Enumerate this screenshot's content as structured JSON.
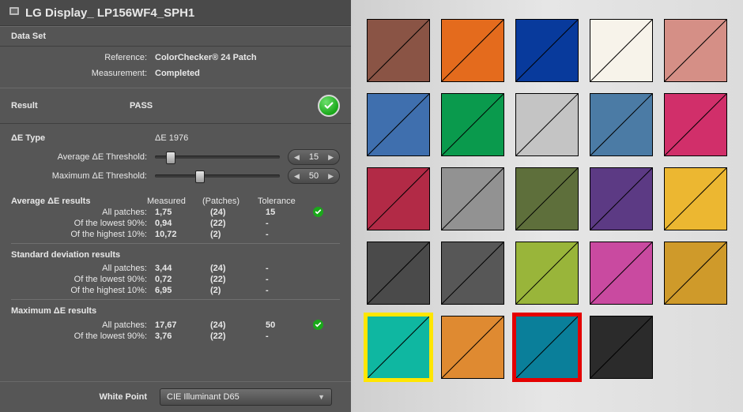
{
  "title": "LG Display_  LP156WF4_SPH1",
  "dataset": {
    "section_label": "Data Set",
    "reference_label": "Reference:",
    "reference_value": "ColorChecker® 24 Patch",
    "measurement_label": "Measurement:",
    "measurement_value": "Completed"
  },
  "result": {
    "label": "Result",
    "value": "PASS"
  },
  "de_type": {
    "label": "ΔE Type",
    "value": "ΔE 1976",
    "avg_threshold_label": "Average  ΔE Threshold:",
    "avg_threshold_value": "15",
    "max_threshold_label": "Maximum ΔE Threshold:",
    "max_threshold_value": "50"
  },
  "table": {
    "header_measured": "Measured",
    "header_patches": "(Patches)",
    "header_tolerance": "Tolerance"
  },
  "avg_results": {
    "heading": "Average ΔE results",
    "rows": [
      {
        "label": "All patches:",
        "measured": "1,75",
        "patches": "(24)",
        "tolerance": "15",
        "pass": true
      },
      {
        "label": "Of the lowest 90%:",
        "measured": "0,94",
        "patches": "(22)",
        "tolerance": "-",
        "pass": false
      },
      {
        "label": "Of the highest 10%:",
        "measured": "10,72",
        "patches": "(2)",
        "tolerance": "-",
        "pass": false
      }
    ]
  },
  "std_results": {
    "heading": "Standard deviation results",
    "rows": [
      {
        "label": "All patches:",
        "measured": "3,44",
        "patches": "(24)",
        "tolerance": "-",
        "pass": false
      },
      {
        "label": "Of the lowest 90%:",
        "measured": "0,72",
        "patches": "(22)",
        "tolerance": "-",
        "pass": false
      },
      {
        "label": "Of the highest 10%:",
        "measured": "6,95",
        "patches": "(2)",
        "tolerance": "-",
        "pass": false
      }
    ]
  },
  "max_results": {
    "heading": "Maximum ΔE results",
    "rows": [
      {
        "label": "All patches:",
        "measured": "17,67",
        "patches": "(24)",
        "tolerance": "50",
        "pass": true
      },
      {
        "label": "Of the lowest 90%:",
        "measured": "3,76",
        "patches": "(22)",
        "tolerance": "-",
        "pass": false
      }
    ]
  },
  "white_point": {
    "label": "White Point",
    "value": "CIE Illuminant D65"
  },
  "swatches": [
    {
      "a": "#8a5445",
      "b": "#8a5445"
    },
    {
      "a": "#e46b1d",
      "b": "#e46b1d"
    },
    {
      "a": "#083a9c",
      "b": "#083a9c"
    },
    {
      "a": "#f7f3ea",
      "b": "#f7f3ea"
    },
    {
      "a": "#d58f86",
      "b": "#d58f86"
    },
    {
      "a": "#3f6fae",
      "b": "#3f6fae"
    },
    {
      "a": "#0a9a4d",
      "b": "#0a9a4d"
    },
    {
      "a": "#c4c4c4",
      "b": "#c4c4c4"
    },
    {
      "a": "#4b7ba5",
      "b": "#4b7ba5"
    },
    {
      "a": "#d12f6a",
      "b": "#d12f6a"
    },
    {
      "a": "#b22a46",
      "b": "#b22a46"
    },
    {
      "a": "#929292",
      "b": "#929292"
    },
    {
      "a": "#5e6f3b",
      "b": "#5e6f3b"
    },
    {
      "a": "#5c3a84",
      "b": "#5c3a84"
    },
    {
      "a": "#ecb731",
      "b": "#ecb731"
    },
    {
      "a": "#4a4a4a",
      "b": "#4a4a4a"
    },
    {
      "a": "#575757",
      "b": "#575757"
    },
    {
      "a": "#99b53a",
      "b": "#99b53a"
    },
    {
      "a": "#c94aa0",
      "b": "#c94aa0"
    },
    {
      "a": "#cf9a2a",
      "b": "#cf9a2a"
    },
    {
      "a": "#0fb7a1",
      "b": "#0fb7a1",
      "highlight": "yellow"
    },
    {
      "a": "#df8a31",
      "b": "#df8a31"
    },
    {
      "a": "#0a7f9a",
      "b": "#0a7f9a",
      "highlight": "red"
    },
    {
      "a": "#2b2b2b",
      "b": "#2b2b2b"
    }
  ]
}
